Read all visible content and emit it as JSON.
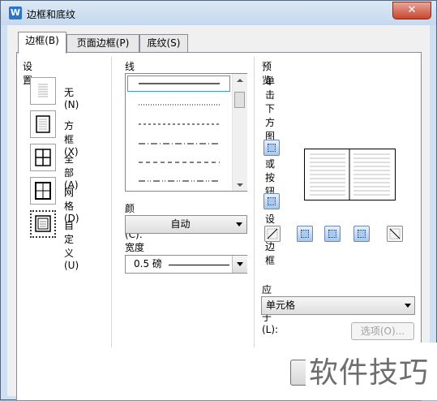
{
  "window": {
    "title": "边框和底纹",
    "app_icon": "W",
    "close_label": "✕"
  },
  "tabs": [
    {
      "label": "边框(B)",
      "active": true
    },
    {
      "label": "页面边框(P)",
      "active": false
    },
    {
      "label": "底纹(S)",
      "active": false
    }
  ],
  "settings": {
    "heading": "设置:",
    "items": [
      {
        "label": "无(N)",
        "icon": "none-border-icon"
      },
      {
        "label": "方框(X)",
        "icon": "box-border-icon"
      },
      {
        "label": "全部(A)",
        "icon": "all-border-icon"
      },
      {
        "label": "网格(D)",
        "icon": "grid-border-icon"
      },
      {
        "label": "自定义(U)",
        "icon": "custom-border-icon"
      }
    ]
  },
  "line_style": {
    "label": "线型(Y):",
    "styles": [
      "solid",
      "dotted",
      "dashed",
      "dash-dot",
      "long-dash",
      "dash-dot-dot"
    ]
  },
  "color": {
    "label": "颜色(C):",
    "value": "自动"
  },
  "width": {
    "label": "宽度(W):",
    "value": "0.5 磅"
  },
  "preview": {
    "heading": "预览",
    "hint": "单击下方图示或按钮可设置边框"
  },
  "apply_to": {
    "label": "应用于(L):",
    "value": "单元格"
  },
  "buttons": {
    "options": "选项(O)..."
  },
  "watermark": "软件技巧"
}
